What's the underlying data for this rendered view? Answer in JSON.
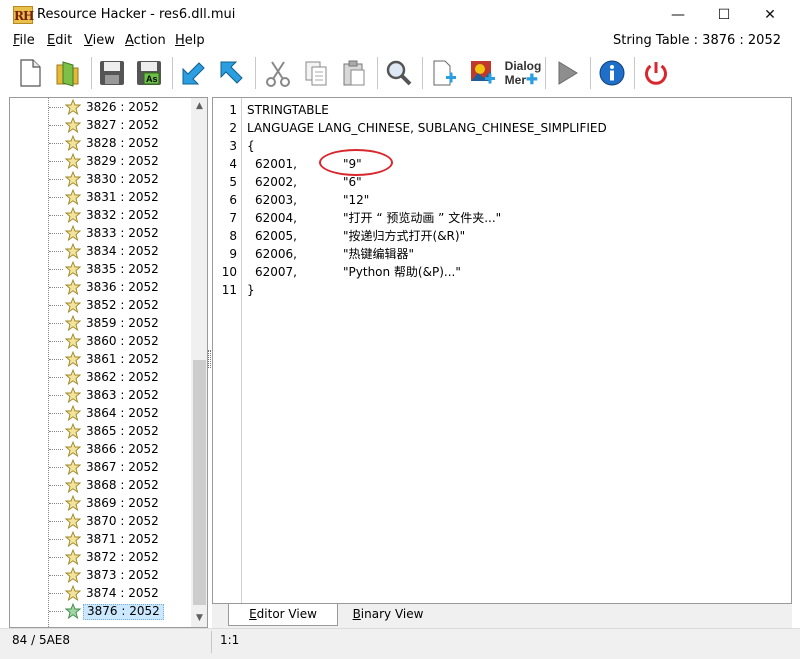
{
  "window": {
    "title": "Resource Hacker  -  res6.dll.mui",
    "logo_text": "RH",
    "minimize_glyph": "—",
    "maximize_glyph": "☐",
    "close_glyph": "✕"
  },
  "menu": {
    "items": [
      "File",
      "Edit",
      "View",
      "Action",
      "Help"
    ],
    "resource_indicator": "String Table : 3876 : 2052"
  },
  "toolbar": {
    "buttons": [
      "new-file-icon",
      "open-folder-icon",
      "save-icon",
      "save-as-icon",
      "compile-arrow-icon",
      "jump-arrow-icon",
      "cut-icon",
      "copy-icon",
      "paste-icon",
      "search-icon",
      "add-resource-icon",
      "add-image-icon",
      "dialog-menu-icon",
      "run-script-icon",
      "info-icon",
      "exit-icon"
    ],
    "save_as_badge": "As",
    "dialog_menu_line1": "Dialog",
    "dialog_menu_line2": "Mer"
  },
  "tree": {
    "items": [
      "3826 : 2052",
      "3827 : 2052",
      "3828 : 2052",
      "3829 : 2052",
      "3830 : 2052",
      "3831 : 2052",
      "3832 : 2052",
      "3833 : 2052",
      "3834 : 2052",
      "3835 : 2052",
      "3836 : 2052",
      "3852 : 2052",
      "3859 : 2052",
      "3860 : 2052",
      "3861 : 2052",
      "3862 : 2052",
      "3863 : 2052",
      "3864 : 2052",
      "3865 : 2052",
      "3866 : 2052",
      "3867 : 2052",
      "3868 : 2052",
      "3869 : 2052",
      "3870 : 2052",
      "3871 : 2052",
      "3872 : 2052",
      "3873 : 2052",
      "3874 : 2052",
      "3876 : 2052"
    ],
    "selected": "3876 : 2052",
    "scroll_up_glyph": "▲",
    "scroll_down_glyph": "▼"
  },
  "editor": {
    "line_numbers": [
      "1",
      "2",
      "3",
      "4",
      "5",
      "6",
      "7",
      "8",
      "9",
      "10",
      "11"
    ],
    "header_lines": [
      "STRINGTABLE",
      "LANGUAGE LANG_CHINESE, SUBLANG_CHINESE_SIMPLIFIED",
      "{"
    ],
    "entries": [
      {
        "id": "62001,",
        "value": "\"9\""
      },
      {
        "id": "62002,",
        "value": "\"6\""
      },
      {
        "id": "62003,",
        "value": "\"12\""
      },
      {
        "id": "62004,",
        "value": "\"打开 “ 预览动画 ” 文件夹...\""
      },
      {
        "id": "62005,",
        "value": "\"按递归方式打开(&R)\""
      },
      {
        "id": "62006,",
        "value": "\"热键编辑器\""
      },
      {
        "id": "62007,",
        "value": "\"Python 帮助(&P)...\""
      }
    ],
    "closing_line": "}"
  },
  "tabs": {
    "editor_view": "Editor View",
    "binary_view": "Binary View"
  },
  "status": {
    "left": "84 / 5AE8",
    "cursor_position": "1:1"
  },
  "colors": {
    "annotation_ellipse": "#d9272e",
    "selection": "#cce8ff"
  }
}
